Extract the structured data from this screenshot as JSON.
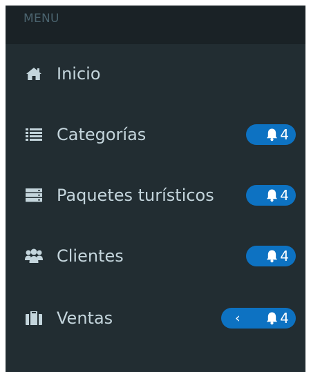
{
  "menu": {
    "header": "MENU",
    "items": [
      {
        "label": "Inicio",
        "icon": "home-icon"
      },
      {
        "label": "Categorías",
        "icon": "list-icon",
        "badge": "4"
      },
      {
        "label": "Paquetes turísticos",
        "icon": "server-icon",
        "badge": "4"
      },
      {
        "label": "Clientes",
        "icon": "users-icon",
        "badge": "4"
      },
      {
        "label": "Ventas",
        "icon": "briefcase-icon",
        "badge": "4",
        "chevron": "‹"
      }
    ]
  },
  "colors": {
    "sidebar_bg": "#222d32",
    "header_bg": "#1a2226",
    "text": "#c4d5dc",
    "badge": "#0d72c2"
  }
}
